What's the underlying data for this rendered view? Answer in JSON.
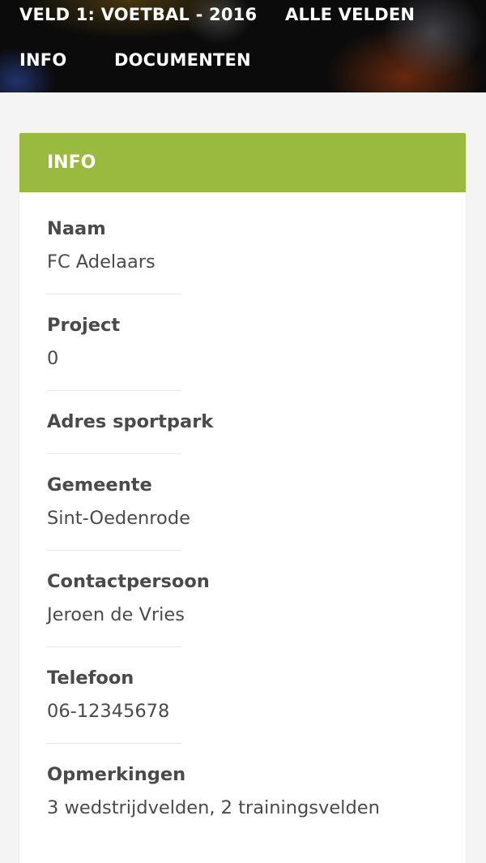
{
  "nav": {
    "title": "VELD 1: VOETBAL - 2016",
    "all_fields": "ALLE VELDEN",
    "info": "INFO",
    "documents": "DOCUMENTEN"
  },
  "card": {
    "title": "INFO",
    "accent_color": "#9aba3f"
  },
  "fields": {
    "naam": {
      "label": "Naam",
      "value": "FC Adelaars"
    },
    "project": {
      "label": "Project",
      "value": "0"
    },
    "adres": {
      "label": "Adres sportpark",
      "value": ""
    },
    "gemeente": {
      "label": "Gemeente",
      "value": "Sint-Oedenrode"
    },
    "contact": {
      "label": "Contactpersoon",
      "value": "Jeroen de Vries"
    },
    "telefoon": {
      "label": "Telefoon",
      "value": "06-12345678"
    },
    "opmerkingen": {
      "label": "Opmerkingen",
      "value": "3 wedstrijdvelden, 2 trainingsvelden"
    }
  }
}
